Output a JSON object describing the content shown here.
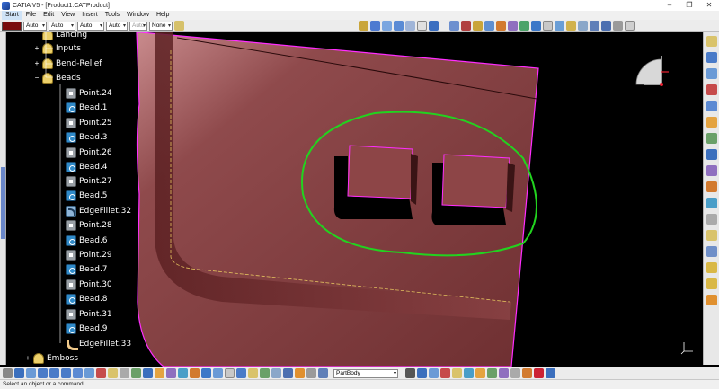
{
  "window": {
    "title": "CATIA V5 - [Product1.CATProduct]",
    "controls": [
      "–",
      "❐",
      "✕"
    ]
  },
  "menu": {
    "items": [
      "Start",
      "File",
      "Edit",
      "View",
      "Insert",
      "Tools",
      "Window",
      "Help"
    ]
  },
  "properties_bar": {
    "color": "#7a0d0d",
    "transparency": "Auto",
    "line_thickness": "Auto",
    "line_type": "Auto",
    "point_type": "Auto",
    "layer_auto": "Auto",
    "layer": "None"
  },
  "tree": {
    "items": [
      {
        "label": "Lancing",
        "icon": "group-icon",
        "expander": ""
      },
      {
        "label": "Inputs",
        "icon": "group-icon",
        "expander": "+"
      },
      {
        "label": "Bend-Relief",
        "icon": "group-icon",
        "expander": "+"
      },
      {
        "label": "Beads",
        "icon": "group-icon",
        "expander": "−"
      },
      {
        "label": "Point.24",
        "icon": "point-icon",
        "expander": ""
      },
      {
        "label": "Bead.1",
        "icon": "bead-icon",
        "expander": ""
      },
      {
        "label": "Point.25",
        "icon": "point-icon",
        "expander": ""
      },
      {
        "label": "Bead.3",
        "icon": "bead-icon",
        "expander": ""
      },
      {
        "label": "Point.26",
        "icon": "point-icon",
        "expander": ""
      },
      {
        "label": "Bead.4",
        "icon": "bead-icon",
        "expander": ""
      },
      {
        "label": "Point.27",
        "icon": "point-icon",
        "expander": ""
      },
      {
        "label": "Bead.5",
        "icon": "bead-icon",
        "expander": ""
      },
      {
        "label": "EdgeFillet.32",
        "icon": "fillet-icon",
        "expander": ""
      },
      {
        "label": "Point.28",
        "icon": "point-icon",
        "expander": ""
      },
      {
        "label": "Bead.6",
        "icon": "bead-icon",
        "expander": ""
      },
      {
        "label": "Point.29",
        "icon": "point-icon",
        "expander": ""
      },
      {
        "label": "Bead.7",
        "icon": "bead-icon",
        "expander": ""
      },
      {
        "label": "Point.30",
        "icon": "point-icon",
        "expander": ""
      },
      {
        "label": "Bead.8",
        "icon": "bead-icon",
        "expander": ""
      },
      {
        "label": "Point.31",
        "icon": "point-icon",
        "expander": ""
      },
      {
        "label": "Bead.9",
        "icon": "bead-icon",
        "expander": ""
      },
      {
        "label": "EdgeFillet.33",
        "icon": "fillet33-icon",
        "expander": ""
      },
      {
        "label": "Emboss",
        "icon": "group-icon",
        "expander": "+"
      }
    ]
  },
  "bottom_toolbar": {
    "body_select": "PartBody"
  },
  "status": {
    "message": "Select an object or a command"
  },
  "colors": {
    "part_surface": "#7d3a3c",
    "selection_highlight": "#ff2dff",
    "annotation_stroke": "#22d31f",
    "viewport_background": "#000000"
  }
}
